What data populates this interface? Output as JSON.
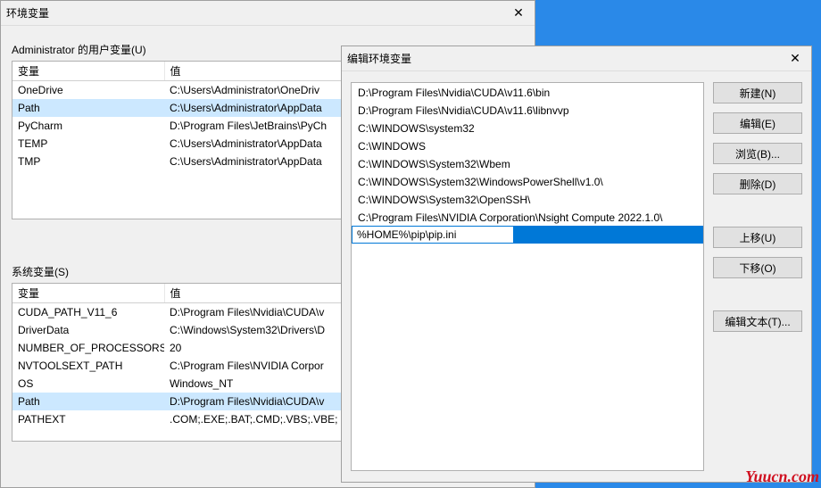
{
  "env_window": {
    "title": "环境变量",
    "user_section_label": "Administrator 的用户变量(U)",
    "sys_section_label": "系统变量(S)",
    "col_var": "变量",
    "col_val": "值",
    "user_vars": [
      {
        "name": "OneDrive",
        "value": "C:\\Users\\Administrator\\OneDriv"
      },
      {
        "name": "Path",
        "value": "C:\\Users\\Administrator\\AppData"
      },
      {
        "name": "PyCharm",
        "value": "D:\\Program Files\\JetBrains\\PyCh"
      },
      {
        "name": "TEMP",
        "value": "C:\\Users\\Administrator\\AppData"
      },
      {
        "name": "TMP",
        "value": "C:\\Users\\Administrator\\AppData"
      }
    ],
    "sys_vars": [
      {
        "name": "CUDA_PATH_V11_6",
        "value": "D:\\Program Files\\Nvidia\\CUDA\\v"
      },
      {
        "name": "DriverData",
        "value": "C:\\Windows\\System32\\Drivers\\D"
      },
      {
        "name": "NUMBER_OF_PROCESSORS",
        "value": "20"
      },
      {
        "name": "NVTOOLSEXT_PATH",
        "value": "C:\\Program Files\\NVIDIA Corpor"
      },
      {
        "name": "OS",
        "value": "Windows_NT"
      },
      {
        "name": "Path",
        "value": "D:\\Program Files\\Nvidia\\CUDA\\v"
      },
      {
        "name": "PATHEXT",
        "value": ".COM;.EXE;.BAT;.CMD;.VBS;.VBE;"
      }
    ],
    "user_selected": 1,
    "sys_selected": 5,
    "btn_new": "新建(N)..."
  },
  "edit_window": {
    "title": "编辑环境变量",
    "entries": [
      "D:\\Program Files\\Nvidia\\CUDA\\v11.6\\bin",
      "D:\\Program Files\\Nvidia\\CUDA\\v11.6\\libnvvp",
      "C:\\WINDOWS\\system32",
      "C:\\WINDOWS",
      "C:\\WINDOWS\\System32\\Wbem",
      "C:\\WINDOWS\\System32\\WindowsPowerShell\\v1.0\\",
      "C:\\WINDOWS\\System32\\OpenSSH\\",
      "C:\\Program Files\\NVIDIA Corporation\\Nsight Compute 2022.1.0\\"
    ],
    "editing_value": "%HOME%\\pip\\pip.ini",
    "buttons": {
      "new": "新建(N)",
      "edit": "编辑(E)",
      "browse": "浏览(B)...",
      "delete": "删除(D)",
      "up": "上移(U)",
      "down": "下移(O)",
      "edit_text": "编辑文本(T)..."
    }
  },
  "watermark": "Yuucn.com"
}
